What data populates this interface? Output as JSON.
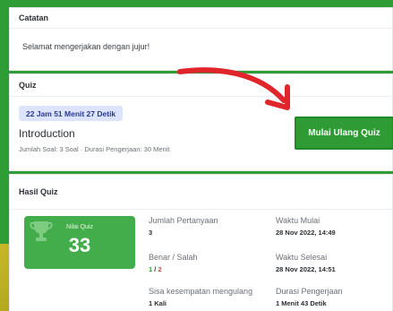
{
  "catatan": {
    "title": "Catatan",
    "note": "Selamat mengerjakan dengan jujur!"
  },
  "quiz": {
    "section_title": "Quiz",
    "timer": "22 Jam 51 Menit 27 Detik",
    "title": "Introduction",
    "meta": "Jumlah Soal: 3 Soal · Durasi Pengerjaan: 30 Menit",
    "button_label": "Mulai Ulang Quiz"
  },
  "hasil": {
    "section_title": "Hasil Quiz",
    "score_label": "Nilai Quiz",
    "score_value": "33",
    "jumlah_label": "Jumlah Pertanyaan",
    "jumlah_value": "3",
    "benar_label": "Benar / Salah",
    "benar_value": "1",
    "slash": " / ",
    "salah_value": "2",
    "sisa_label": "Sisa kesempatan mengulang",
    "sisa_value": "1 Kali",
    "mulai_label": "Waktu Mulai",
    "mulai_value": "28 Nov 2022, 14:49",
    "selesai_label": "Waktu Selesai",
    "selesai_value": "28 Nov 2022, 14:51",
    "durasi_label": "Durasi Pengerjaan",
    "durasi_value": "1 Menit 43 Detik"
  },
  "colors": {
    "primary": "#2e9b35",
    "arrow": "#e0262b",
    "timer_bg": "#dde4ff"
  }
}
